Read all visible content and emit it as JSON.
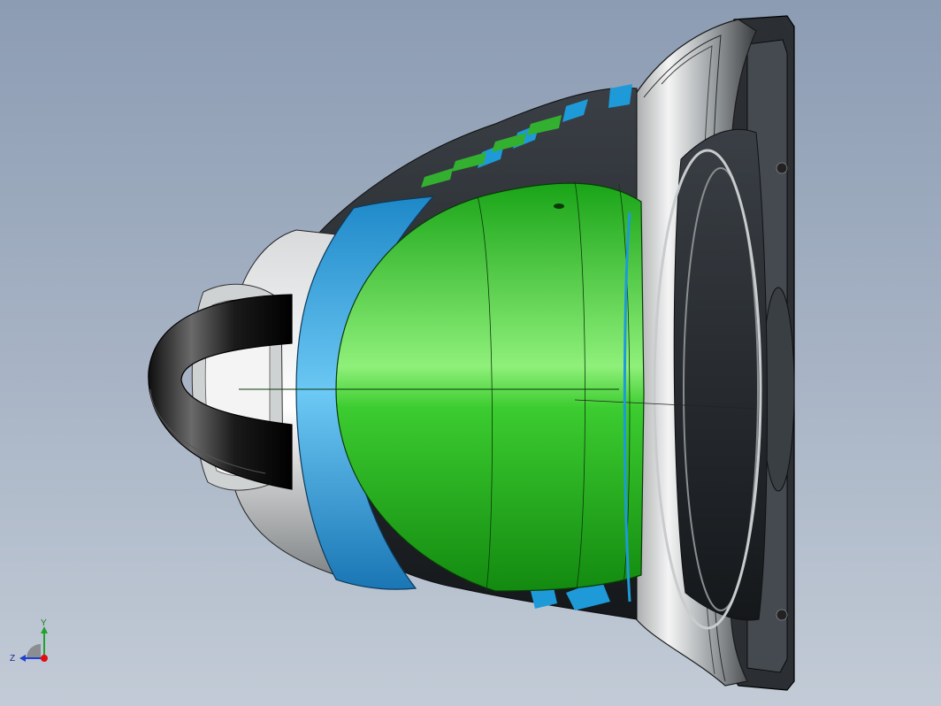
{
  "viewport": {
    "background_top": "#8c9cb3",
    "background_bottom": "#c2cbd6"
  },
  "model": {
    "colors": {
      "green_shell": "#22b01e",
      "blue_band": "#1e9ad8",
      "dark_body": "#2a2e33",
      "metal_rim": "#b8bcbf",
      "handle": "#1a1a1a"
    }
  },
  "triad": {
    "y_label": "Y",
    "z_label": "Z",
    "colors": {
      "y": "#22a030",
      "z": "#2040d0",
      "x": "#e01010"
    }
  }
}
